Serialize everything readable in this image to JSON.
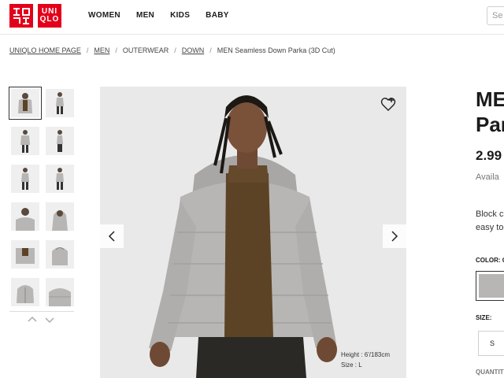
{
  "header": {
    "logo_top": "UNI",
    "logo_bottom": "QLO",
    "nav": [
      "WOMEN",
      "MEN",
      "KIDS",
      "BABY"
    ],
    "search_placeholder": "Se"
  },
  "breadcrumb": {
    "home": "UNIQLO HOME PAGE",
    "men": "MEN",
    "outerwear": "OUTERWEAR",
    "down": "DOWN",
    "current": "MEN Seamless Down Parka (3D Cut)"
  },
  "main_image": {
    "model_height": "Height : 6'/183cm",
    "model_size": "Size : L"
  },
  "product": {
    "title_line1": "MEN",
    "title_line2": "Park",
    "price": "2.99",
    "availability": "Availa",
    "desc_line1": "Block c",
    "desc_line2": "easy to",
    "color_label": "COLOR: G",
    "size_label": "SIZE:",
    "size_value": "S",
    "quantity_label": "QUANTITY"
  },
  "colors": {
    "brand": "#e3001b",
    "jacket": "#b8b6b4"
  },
  "icons": {
    "wishlist": "heart-plus-icon",
    "prev": "chevron-left-icon",
    "next": "chevron-right-icon"
  }
}
